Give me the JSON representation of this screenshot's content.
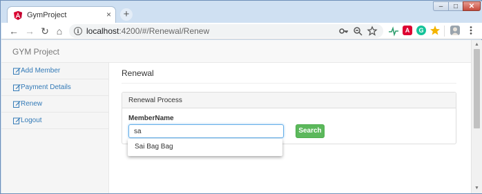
{
  "browser": {
    "tab_title": "GymProject",
    "tab_close": "×",
    "new_tab": "+",
    "url_host": "localhost",
    "url_path": ":4200/#/Renewal/Renew",
    "window_controls": {
      "minimize": "–",
      "maximize": "□",
      "close": "✕"
    },
    "nav_icons": {
      "back": "←",
      "forward": "→",
      "reload": "↻",
      "home": "⌂"
    },
    "extension_letters": {
      "angular": "A",
      "grammarly": "G"
    },
    "accent_colors": {
      "angular": "#dd0031",
      "grammarly": "#15c39a",
      "star": "#f4b400"
    }
  },
  "app": {
    "brand": "GYM Project",
    "sidebar": {
      "items": [
        {
          "label": "Add Member",
          "icon": "edit-icon"
        },
        {
          "label": "Payment Details",
          "icon": "edit-icon"
        },
        {
          "label": "Renew",
          "icon": "edit-icon"
        },
        {
          "label": "Logout",
          "icon": "edit-icon"
        }
      ]
    },
    "page_title": "Renewal",
    "panel": {
      "heading": "Renewal Process",
      "field_label": "MemberName",
      "input_value": "sa",
      "search_label": "Search"
    },
    "autocomplete": {
      "options": [
        "Sai Bag Bag"
      ]
    }
  },
  "colors": {
    "link": "#337ab7",
    "search_button": "#5cb85c",
    "input_focus": "#66afe9"
  }
}
